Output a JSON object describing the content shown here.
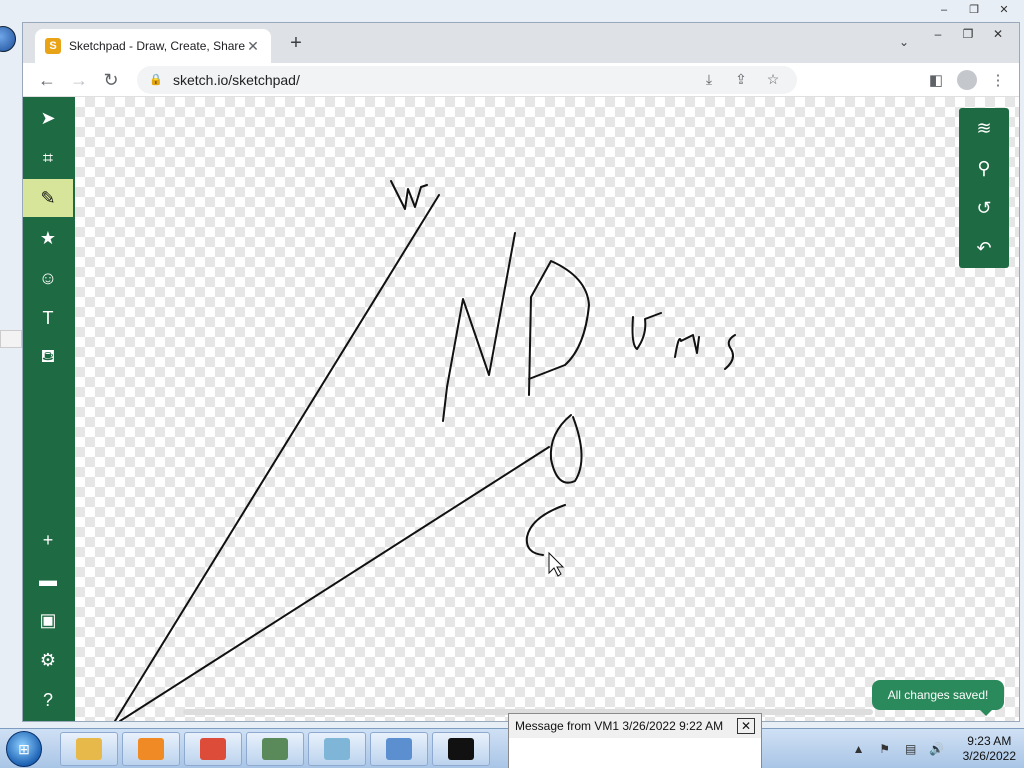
{
  "desktop": {
    "outer_controls": [
      "–",
      "❐",
      "✕"
    ],
    "inner_controls": [
      "–",
      "❐",
      "✕"
    ]
  },
  "browser": {
    "tab": {
      "favicon": "S",
      "title": "Sketchpad - Draw, Create, Share!",
      "close": "✕"
    },
    "new_tab": "+",
    "tab_dropdown": "⌄",
    "nav": {
      "back": "←",
      "forward": "→",
      "reload": "↻"
    },
    "address": {
      "lock": "🔒",
      "url": "sketch.io/sketchpad/"
    },
    "omnibox_actions": {
      "install": "⤓",
      "share": "⇪",
      "bookmark": "☆"
    },
    "toolbar_right": {
      "side_panel": "◧",
      "menu": "⋮"
    }
  },
  "sketchpad": {
    "left_tools": [
      {
        "name": "select-tool",
        "icon": "arrow-pointer-icon",
        "glyph": "➤",
        "active": false
      },
      {
        "name": "crop-tool",
        "icon": "crop-icon",
        "glyph": "⌗",
        "active": false
      },
      {
        "name": "pencil-tool",
        "icon": "pencil-icon",
        "glyph": "✎",
        "active": true
      },
      {
        "name": "stamp-tool",
        "icon": "star-icon",
        "glyph": "★",
        "active": false
      },
      {
        "name": "emoji-tool",
        "icon": "smile-icon",
        "glyph": "☺",
        "active": false
      },
      {
        "name": "text-tool",
        "icon": "text-icon",
        "glyph": "T",
        "active": false
      },
      {
        "name": "fill-tool",
        "icon": "paint-bucket-icon",
        "glyph": "⛾",
        "active": false
      }
    ],
    "left_bottom": [
      {
        "name": "new-button",
        "icon": "plus-icon",
        "glyph": "+"
      },
      {
        "name": "open-button",
        "icon": "folder-icon",
        "glyph": "▬"
      },
      {
        "name": "save-button",
        "icon": "floppy-icon",
        "glyph": "▣"
      },
      {
        "name": "settings-button",
        "icon": "gears-icon",
        "glyph": "⚙"
      },
      {
        "name": "help-button",
        "icon": "question-icon",
        "glyph": "?"
      }
    ],
    "right_tools": [
      {
        "name": "layers-button",
        "icon": "layers-icon",
        "glyph": "≋"
      },
      {
        "name": "zoom-button",
        "icon": "search-icon",
        "glyph": "⚲"
      },
      {
        "name": "history-button",
        "icon": "history-icon",
        "glyph": "↺"
      },
      {
        "name": "undo-button",
        "icon": "undo-icon",
        "glyph": "↶"
      }
    ],
    "toast": "All changes saved!"
  },
  "notification": {
    "title": "Message from VM1 3/26/2022 9:22 AM",
    "close": "✕",
    "body": ""
  },
  "taskbar": {
    "start_glyph": "⊞",
    "apps": [
      {
        "name": "explorer",
        "color": "#e7b84a"
      },
      {
        "name": "media-player",
        "color": "#f08a24"
      },
      {
        "name": "chrome",
        "color": "#dd4b39"
      },
      {
        "name": "network-monitor",
        "color": "#5a8a5a"
      },
      {
        "name": "notepad",
        "color": "#7fb6d8"
      },
      {
        "name": "control-panel",
        "color": "#5b8fd0"
      },
      {
        "name": "cmd",
        "color": "#111111"
      }
    ],
    "tray_icons": [
      "▲",
      "⚑",
      "▤",
      "🔊"
    ],
    "time": "9:23 AM",
    "date": "3/26/2022"
  }
}
